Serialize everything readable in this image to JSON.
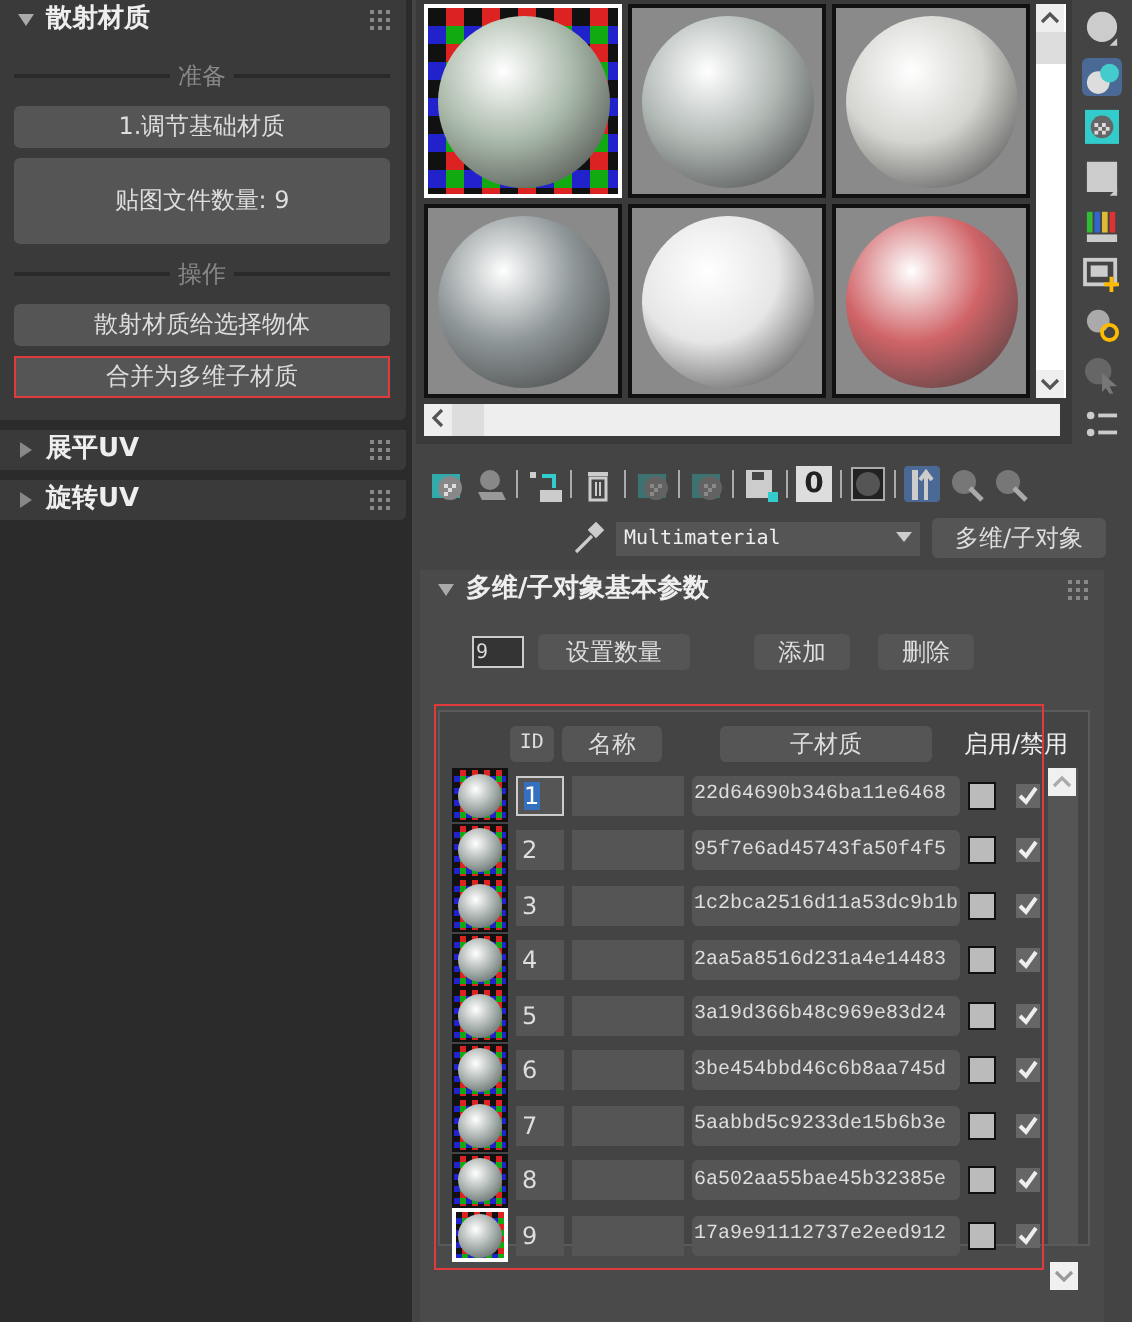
{
  "left_panel": {
    "rollouts": [
      {
        "title": "散射材质",
        "expanded": true,
        "groups": [
          {
            "label": "准备",
            "buttons": [
              {
                "label": "1.调节基础材质",
                "kind": "normal",
                "highlighted": false
              },
              {
                "label": "贴图文件数量: 9",
                "kind": "tall",
                "highlighted": false
              }
            ]
          },
          {
            "label": "操作",
            "buttons": [
              {
                "label": "散射材质给选择物体",
                "kind": "normal",
                "highlighted": false
              },
              {
                "label": "合并为多维子材质",
                "kind": "normal",
                "highlighted": true
              }
            ]
          }
        ]
      },
      {
        "title": "展平UV",
        "expanded": false
      },
      {
        "title": "旋转UV",
        "expanded": false
      }
    ]
  },
  "sample_slots": [
    {
      "color": "#a8b8a8",
      "checker": true,
      "selected": true
    },
    {
      "color": "#b0b8b4",
      "checker": false,
      "selected": false
    },
    {
      "color": "#d4d4d0",
      "checker": false,
      "selected": false
    },
    {
      "color": "#8e9698",
      "checker": false,
      "selected": false
    },
    {
      "color": "#e6e6e6",
      "checker": false,
      "selected": false
    },
    {
      "color": "#d06468",
      "checker": false,
      "selected": false
    }
  ],
  "side_tools": [
    {
      "kind": "sphere",
      "selected": false
    },
    {
      "kind": "spheres",
      "selected": true
    },
    {
      "kind": "checker",
      "selected": false
    },
    {
      "kind": "square",
      "selected": false
    },
    {
      "kind": "bars",
      "selected": false
    },
    {
      "kind": "film",
      "selected": false
    },
    {
      "kind": "gear",
      "selected": false
    },
    {
      "kind": "cursor",
      "selected": false
    },
    {
      "kind": "list",
      "selected": false
    }
  ],
  "toolbar": [
    {
      "kind": "checker",
      "disabled": false,
      "selected": false
    },
    {
      "kind": "layers",
      "disabled": false,
      "selected": false
    },
    {
      "kind": "separator"
    },
    {
      "kind": "assign",
      "disabled": false,
      "selected": false
    },
    {
      "kind": "separator"
    },
    {
      "kind": "trash",
      "disabled": false,
      "selected": false
    },
    {
      "kind": "separator"
    },
    {
      "kind": "checker",
      "disabled": true,
      "selected": false
    },
    {
      "kind": "separator"
    },
    {
      "kind": "checker",
      "disabled": true,
      "selected": false
    },
    {
      "kind": "separator"
    },
    {
      "kind": "save",
      "disabled": false,
      "selected": false
    },
    {
      "kind": "separator"
    },
    {
      "kind": "zero",
      "label": "0",
      "disabled": false,
      "selected": false
    },
    {
      "kind": "separator"
    },
    {
      "kind": "square",
      "disabled": false,
      "selected": false
    },
    {
      "kind": "separator"
    },
    {
      "kind": "pick",
      "disabled": false,
      "selected": true
    },
    {
      "kind": "magnify",
      "disabled": false,
      "selected": false
    },
    {
      "kind": "magnify",
      "disabled": false,
      "selected": false
    }
  ],
  "material_row": {
    "material_name": "Multimaterial",
    "type_button": "多维/子对象"
  },
  "params_rollout": {
    "title": "多维/子对象基本参数",
    "expanded": true,
    "count": "9",
    "buttons": [
      "设置数量",
      "添加",
      "删除"
    ],
    "table": {
      "highlighted": true,
      "columns": [
        "ID",
        "名称",
        "子材质",
        "启用/禁用"
      ],
      "rows": [
        {
          "id": "1",
          "submaterial": "22d64690b346ba11e6468",
          "id_focused": true,
          "slot_active": false,
          "enabled": true
        },
        {
          "id": "2",
          "submaterial": "95f7e6ad45743fa50f4f5",
          "id_focused": false,
          "slot_active": false,
          "enabled": true
        },
        {
          "id": "3",
          "submaterial": "1c2bca2516d11a53dc9b1b",
          "id_focused": false,
          "slot_active": false,
          "enabled": true
        },
        {
          "id": "4",
          "submaterial": "2aa5a8516d231a4e14483",
          "id_focused": false,
          "slot_active": false,
          "enabled": true
        },
        {
          "id": "5",
          "submaterial": "3a19d366b48c969e83d24",
          "id_focused": false,
          "slot_active": false,
          "enabled": true
        },
        {
          "id": "6",
          "submaterial": "3be454bbd46c6b8aa745d",
          "id_focused": false,
          "slot_active": false,
          "enabled": true
        },
        {
          "id": "7",
          "submaterial": "5aabbd5c9233de15b6b3e",
          "id_focused": false,
          "slot_active": false,
          "enabled": true
        },
        {
          "id": "8",
          "submaterial": "6a502aa55bae45b32385e",
          "id_focused": false,
          "slot_active": false,
          "enabled": true
        },
        {
          "id": "9",
          "submaterial": "17a9e91112737e2eed912",
          "id_focused": false,
          "slot_active": true,
          "enabled": true
        }
      ]
    }
  }
}
